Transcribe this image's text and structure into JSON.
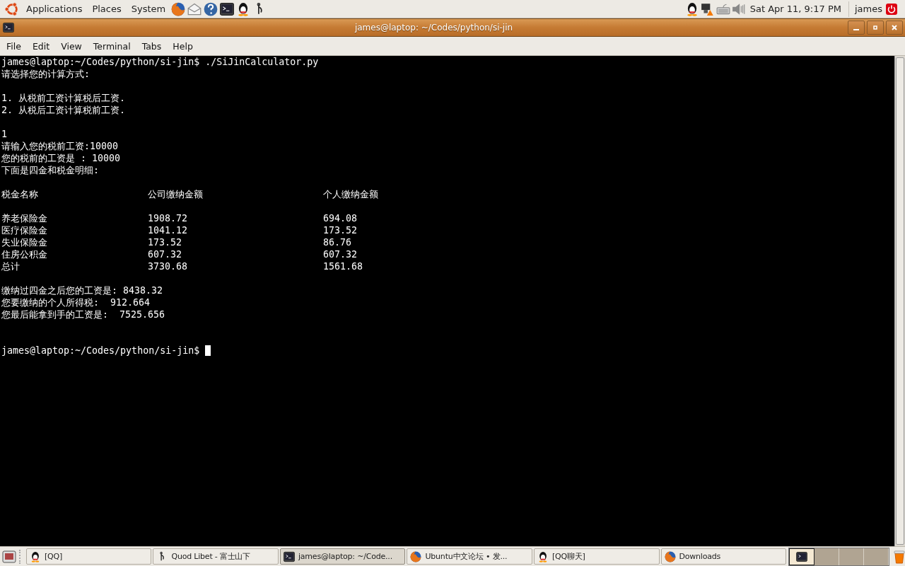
{
  "top_panel": {
    "menus": [
      "Applications",
      "Places",
      "System"
    ],
    "clock": "Sat Apr 11,  9:17 PM",
    "user": "james"
  },
  "window": {
    "title": "james@laptop: ~/Codes/python/si-jin"
  },
  "menu_bar": [
    "File",
    "Edit",
    "View",
    "Terminal",
    "Tabs",
    "Help"
  ],
  "terminal": {
    "lines": [
      {
        "kind": "text",
        "text": "james@laptop:~/Codes/python/si-jin$ ./SiJinCalculator.py"
      },
      {
        "kind": "text",
        "text": "请选择您的计算方式:"
      },
      {
        "kind": "blank"
      },
      {
        "kind": "text",
        "text": "1. 从税前工资计算税后工资."
      },
      {
        "kind": "text",
        "text": "2. 从税后工资计算税前工资."
      },
      {
        "kind": "blank"
      },
      {
        "kind": "text",
        "text": "1"
      },
      {
        "kind": "text",
        "text": "请输入您的税前工资:10000"
      },
      {
        "kind": "text",
        "text": "您的税前的工资是 : 10000"
      },
      {
        "kind": "text",
        "text": "下面是四金和税金明细:"
      },
      {
        "kind": "blank"
      },
      {
        "kind": "row",
        "cells": [
          "税金名称",
          "公司缴纳金额",
          "个人缴纳金额"
        ]
      },
      {
        "kind": "blank"
      },
      {
        "kind": "row",
        "cells": [
          "养老保险金",
          "1908.72",
          "694.08"
        ]
      },
      {
        "kind": "row",
        "cells": [
          "医疗保险金",
          "1041.12",
          "173.52"
        ]
      },
      {
        "kind": "row",
        "cells": [
          "失业保险金",
          "173.52",
          "86.76"
        ]
      },
      {
        "kind": "row",
        "cells": [
          "住房公积金",
          "607.32",
          "607.32"
        ]
      },
      {
        "kind": "row",
        "cells": [
          "总计",
          "3730.68",
          "1561.68"
        ]
      },
      {
        "kind": "blank"
      },
      {
        "kind": "text",
        "text": "缴纳过四金之后您的工资是: 8438.32"
      },
      {
        "kind": "text",
        "text": "您要缴纳的个人所得税:  912.664"
      },
      {
        "kind": "text",
        "text": "您最后能拿到手的工资是:  7525.656"
      },
      {
        "kind": "blank"
      },
      {
        "kind": "blank"
      },
      {
        "kind": "prompt",
        "text": "james@laptop:~/Codes/python/si-jin$ ",
        "cursor": true
      }
    ]
  },
  "taskbar": {
    "tasks": [
      {
        "label": "[QQ]",
        "kind": "penguin",
        "selected": false
      },
      {
        "label": "Quod Libet - 富士山下",
        "kind": "note",
        "selected": false
      },
      {
        "label": "james@laptop: ~/Code...",
        "kind": "terminal",
        "selected": true
      },
      {
        "label": "Ubuntu中文论坛 • 发...",
        "kind": "globe",
        "selected": false
      },
      {
        "label": "[QQ聊天]",
        "kind": "penguin",
        "selected": false
      },
      {
        "label": "Downloads",
        "kind": "globe",
        "selected": false
      }
    ],
    "workspaces": [
      {
        "selected": true
      },
      {
        "selected": false
      },
      {
        "selected": false
      },
      {
        "selected": false
      }
    ]
  }
}
